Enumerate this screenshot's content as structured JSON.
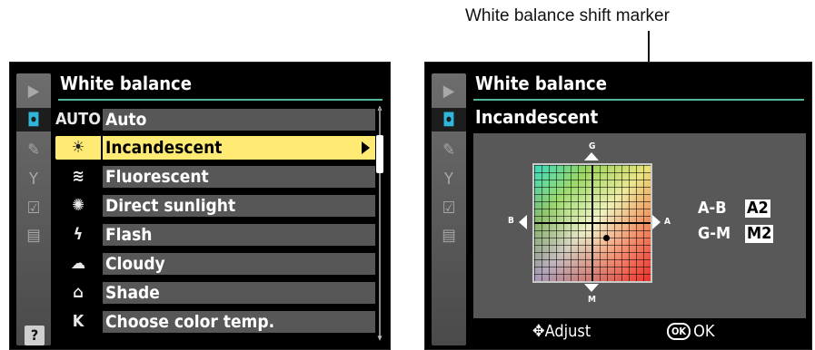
{
  "caption": "White balance shift marker",
  "left_screen": {
    "title": "White balance",
    "rail_icons": [
      "playback-icon",
      "camera-icon",
      "pencil-icon",
      "wrench-icon",
      "retouch-icon",
      "recent-settings-icon",
      "help-icon"
    ],
    "help_label": "?",
    "items": [
      {
        "icon_text": "AUTO",
        "icon": "auto-icon",
        "label": "Auto"
      },
      {
        "icon_text": "☀",
        "icon": "incandescent-bulb-icon",
        "label": "Incandescent",
        "selected": true
      },
      {
        "icon_text": "≋",
        "icon": "fluorescent-icon",
        "label": "Fluorescent"
      },
      {
        "icon_text": "✺",
        "icon": "sun-icon",
        "label": "Direct sunlight"
      },
      {
        "icon_text": "ϟ",
        "icon": "flash-icon",
        "label": "Flash"
      },
      {
        "icon_text": "☁",
        "icon": "cloud-icon",
        "label": "Cloudy"
      },
      {
        "icon_text": "⌂",
        "icon": "shade-icon",
        "label": "Shade"
      },
      {
        "icon_text": "K",
        "icon": "kelvin-icon",
        "label": "Choose color temp."
      }
    ]
  },
  "right_screen": {
    "title": "White balance",
    "subtitle": "Incandescent",
    "axis": {
      "top": "G",
      "bottom": "M",
      "left": "B",
      "right": "A"
    },
    "shift": [
      {
        "label": "A-B",
        "value": "A2"
      },
      {
        "label": "G-M",
        "value": "M2"
      }
    ],
    "hint_adjust": "Adjust",
    "hint_ok_box": "OK",
    "hint_ok": "OK"
  },
  "colors": {
    "selection": "#ffea74",
    "accent_rule": "#55b7a0",
    "active_tab": "#2fb6d8",
    "menu_bg": "#575757"
  }
}
